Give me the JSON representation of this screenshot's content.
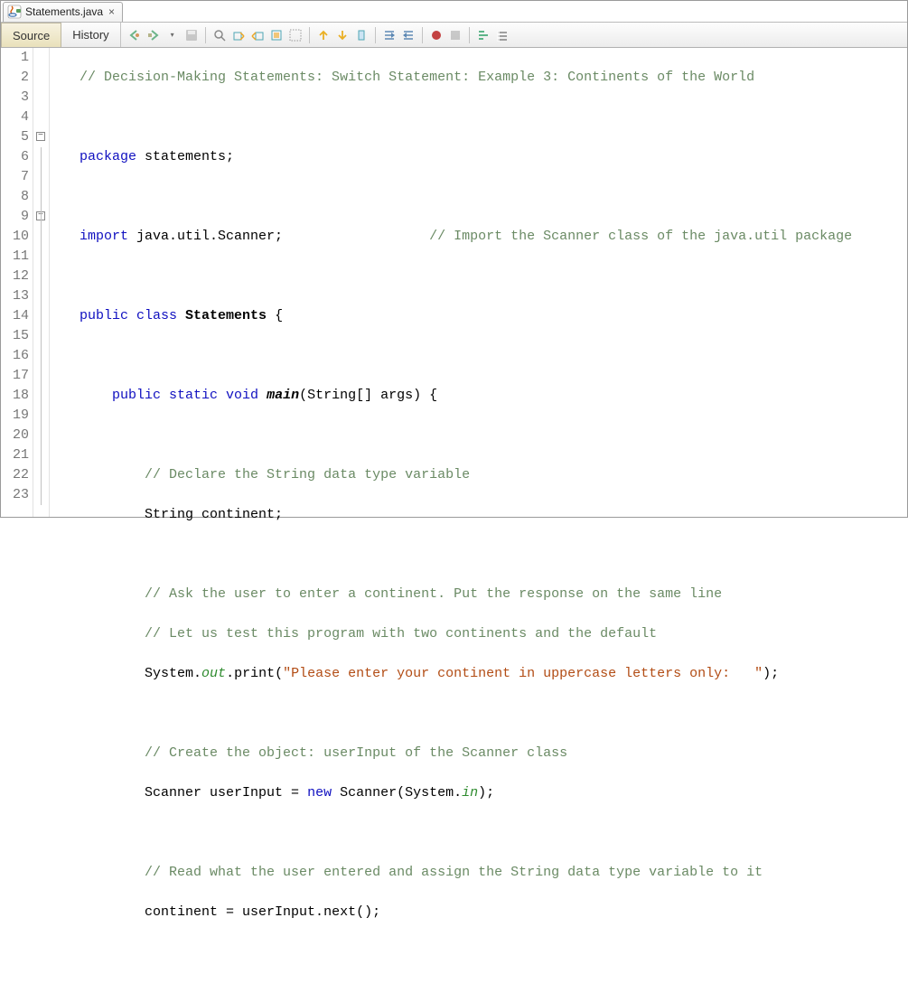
{
  "tab": {
    "filename": "Statements.java"
  },
  "views": {
    "source": "Source",
    "history": "History"
  },
  "code": {
    "l1": "// Decision-Making Statements: Switch Statement: Example 3: Continents of the World",
    "l3p": "package",
    "l3n": " statements;",
    "l5a": "import",
    "l5b": " java.util.Scanner;",
    "l5c": "// Import the Scanner class of the java.util package",
    "l7a": "public",
    "l7b": " class",
    "l7c": " Statements",
    "l7d": " {",
    "l9a": "public",
    "l9b": " static",
    "l9c": " void",
    "l9d": " main",
    "l9e": "(String[] args) {",
    "l11": "// Declare the String data type variable",
    "l12": "String continent;",
    "l14": "// Ask the user to enter a continent. Put the response on the same line",
    "l15": "// Let us test this program with two continents and the default",
    "l16a": "System.",
    "l16b": "out",
    "l16c": ".print(",
    "l16d": "\"Please enter your continent in uppercase letters only:   \"",
    "l16e": ");",
    "l18": "// Create the object: userInput of the Scanner class",
    "l19a": "Scanner userInput = ",
    "l19b": "new",
    "l19c": " Scanner(System.",
    "l19d": "in",
    "l19e": ");",
    "l21": "// Read what the user entered and assign the String data type variable to it",
    "l22": "continent = userInput.next();"
  }
}
